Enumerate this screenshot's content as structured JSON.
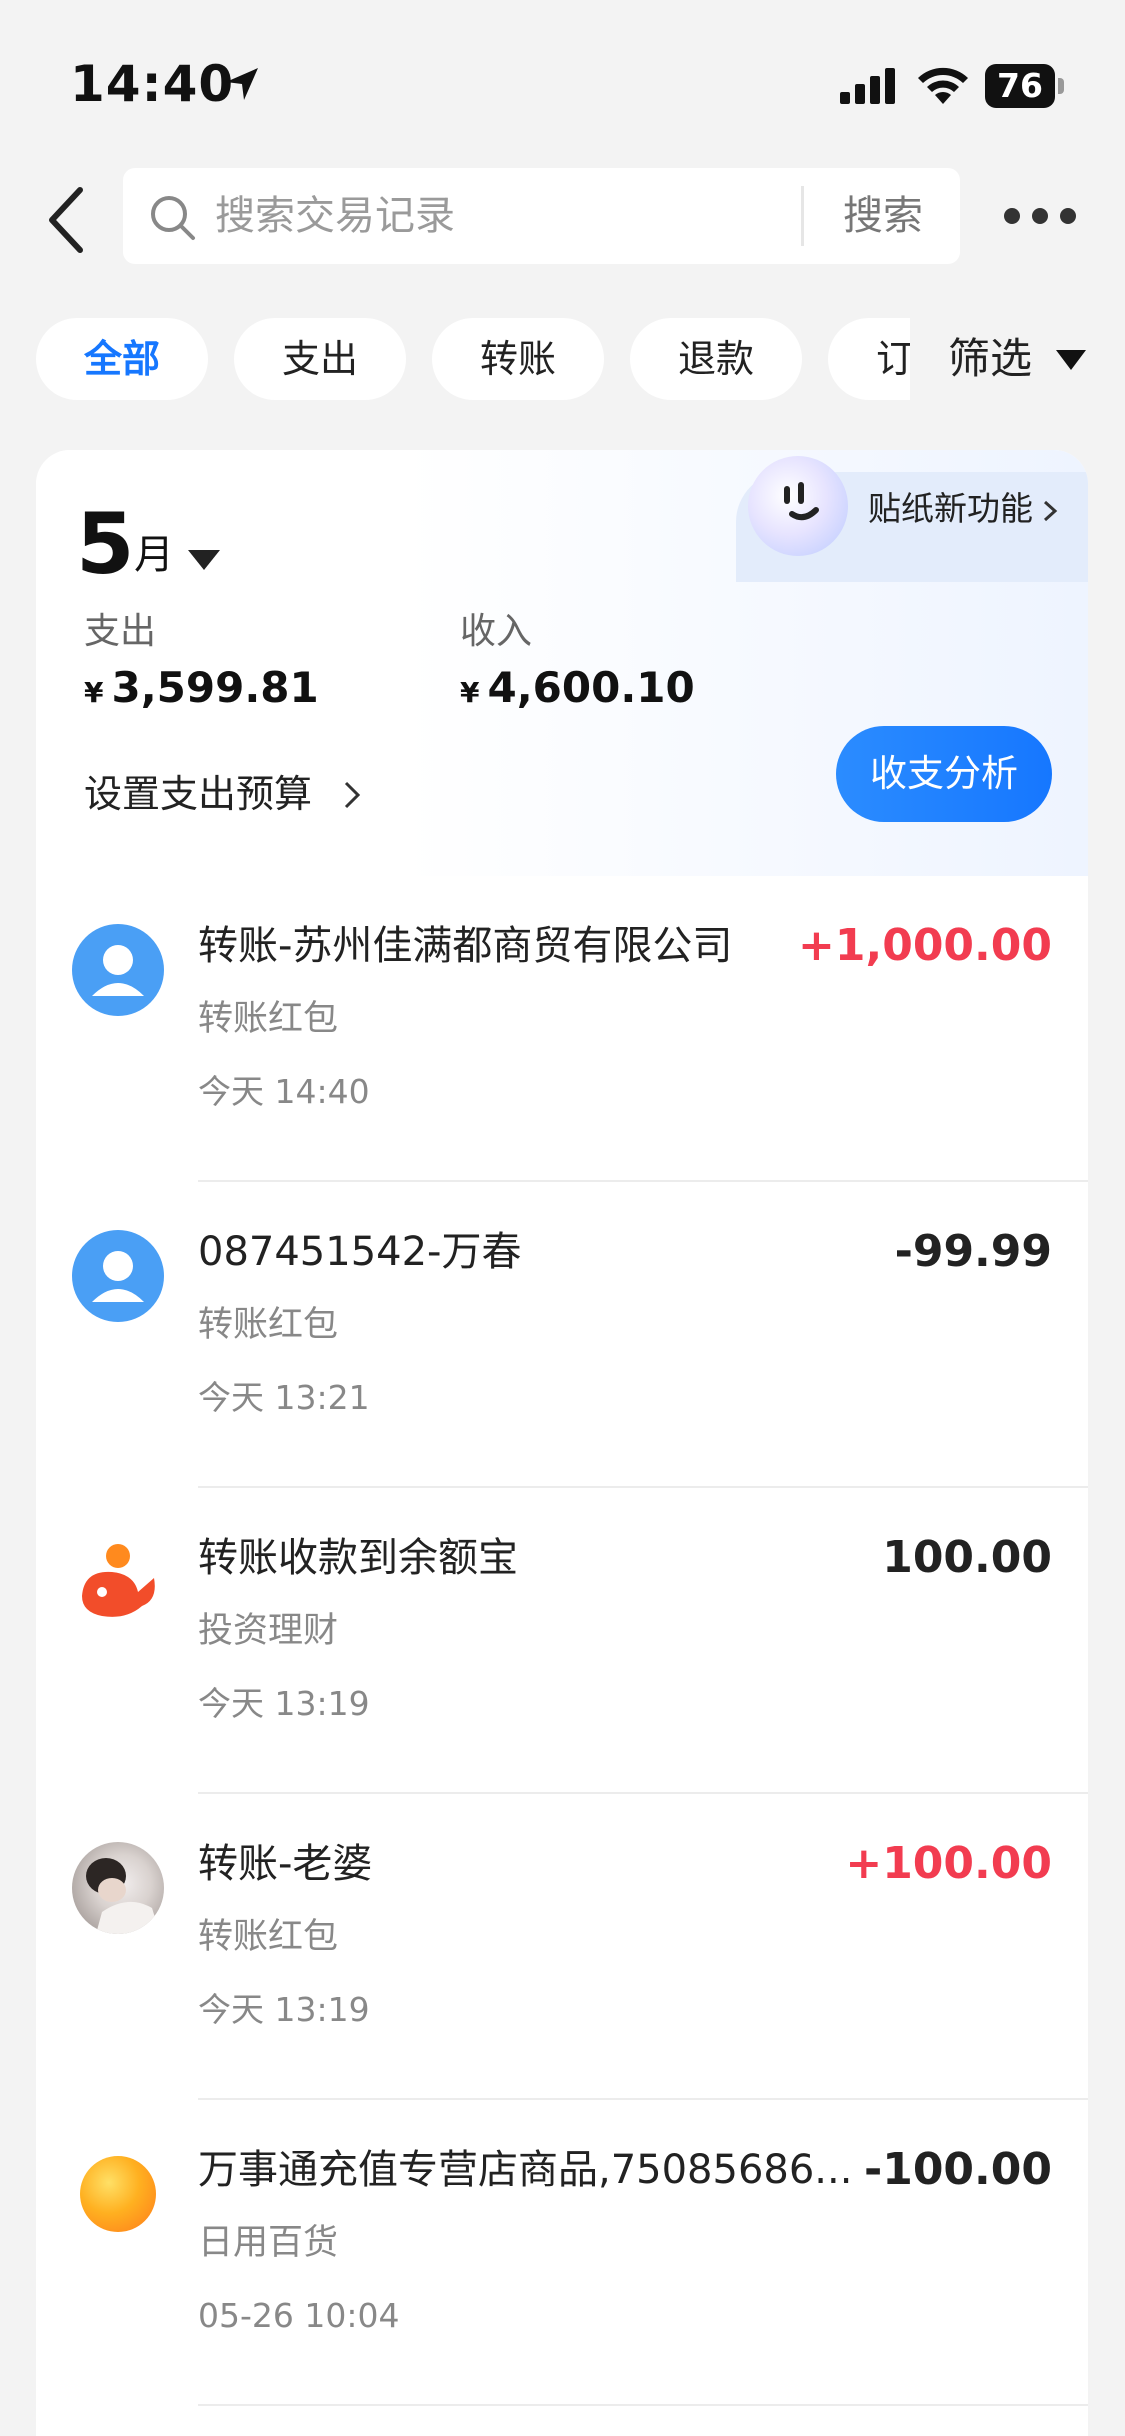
{
  "status_bar": {
    "time": "14:40",
    "battery": "76"
  },
  "header": {
    "search_placeholder": "搜索交易记录",
    "search_button": "搜索"
  },
  "chips": [
    {
      "label": "全部",
      "active": true
    },
    {
      "label": "支出"
    },
    {
      "label": "转账"
    },
    {
      "label": "退款"
    },
    {
      "label": "订单"
    }
  ],
  "filter_label": "筛选",
  "summary": {
    "month": "5",
    "month_unit": "月",
    "sticker_label": "贴纸新功能",
    "expense_label": "支出",
    "expense_currency": "¥",
    "expense_amount": "3,599.81",
    "income_label": "收入",
    "income_currency": "¥",
    "income_amount": "4,600.10",
    "budget_label": "设置支出预算",
    "analysis_button": "收支分析"
  },
  "colors": {
    "accent": "#1677ff",
    "income_red": "#f23c50",
    "avatar_blue": "#4a9ff5"
  },
  "transactions": [
    {
      "title": "转账-苏州佳满都商贸有限公司",
      "amount": "+1,000.00",
      "category": "转账红包",
      "date": "今天 14:40",
      "avatar": "person-icon"
    },
    {
      "title": "087451542-万春",
      "amount": "-99.99",
      "category": "转账红包",
      "date": "今天 13:21",
      "avatar": "person-icon"
    },
    {
      "title": "转账收款到余额宝",
      "amount": "100.00",
      "category": "投资理财",
      "date": "今天 13:19",
      "avatar": "yuebao-icon"
    },
    {
      "title": "转账-老婆",
      "amount": "+100.00",
      "category": "转账红包",
      "date": "今天 13:19",
      "avatar": "photo-avatar"
    },
    {
      "title": "万事通充值专营店商品,75085686...",
      "amount": "-100.00",
      "category": "日用百货",
      "date": "05-26 10:04",
      "avatar": "orange-logo-icon"
    }
  ]
}
